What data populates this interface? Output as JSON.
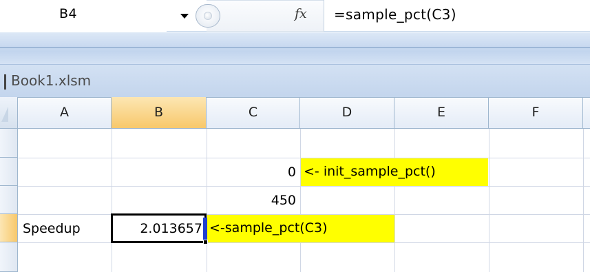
{
  "formula_bar": {
    "name_box": "B4",
    "fx_label": "fx",
    "formula": "=sample_pct(C3)"
  },
  "workbook": {
    "title": "Book1.xlsm"
  },
  "columns": [
    "A",
    "B",
    "C",
    "D",
    "E",
    "F"
  ],
  "selected_column": "B",
  "cells": {
    "C2": "0",
    "D2": "<- init_sample_pct()",
    "C3": "450",
    "A4": "Speedup",
    "B4": "2.013657",
    "C4": "<-sample_pct(C3)"
  },
  "colors": {
    "highlight": "#ffff00",
    "selected_header": "#f8c86b",
    "grid": "#d0d7e5"
  }
}
